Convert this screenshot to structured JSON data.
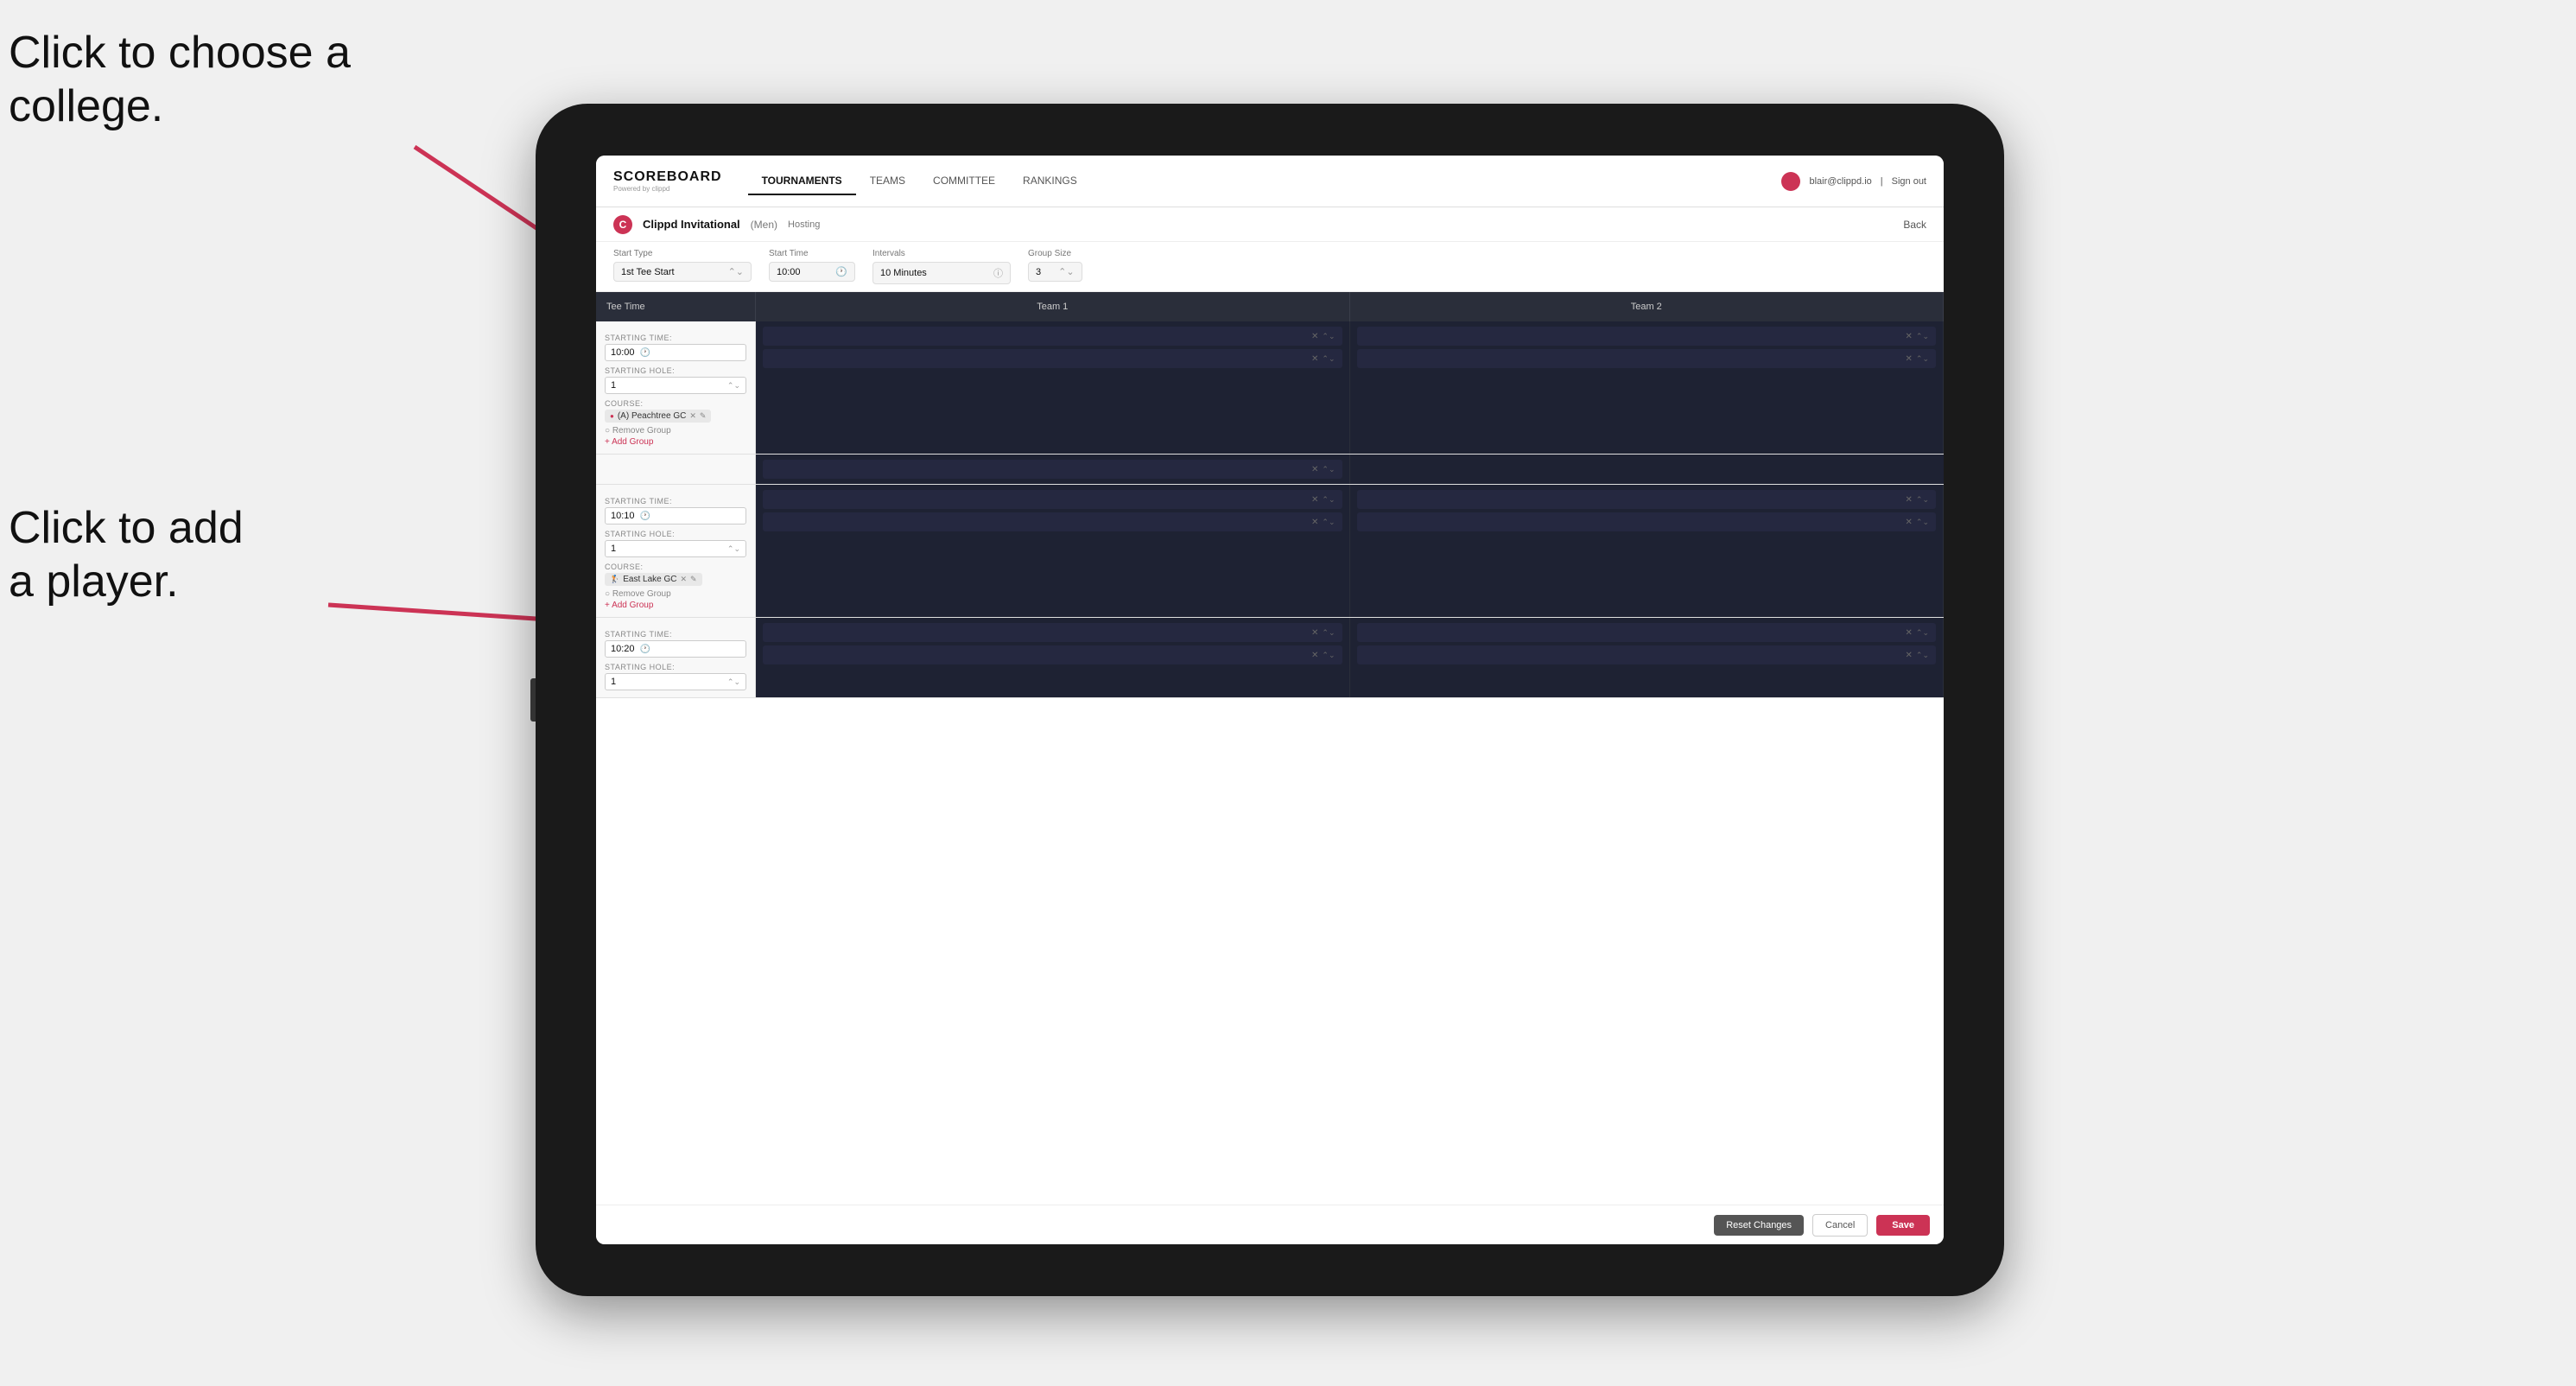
{
  "annotations": {
    "college": "Click to choose a\ncollege.",
    "player": "Click to add\na player."
  },
  "header": {
    "logo_title": "SCOREBOARD",
    "logo_sub": "Powered by clippd",
    "nav_tabs": [
      "TOURNAMENTS",
      "TEAMS",
      "COMMITTEE",
      "RANKINGS"
    ],
    "active_tab": "TOURNAMENTS",
    "user_email": "blair@clippd.io",
    "sign_out": "Sign out"
  },
  "sub_header": {
    "tournament_name": "Clippd Invitational",
    "gender": "(Men)",
    "badge": "Hosting",
    "back": "Back"
  },
  "controls": {
    "start_type_label": "Start Type",
    "start_type_value": "1st Tee Start",
    "start_time_label": "Start Time",
    "start_time_value": "10:00",
    "intervals_label": "Intervals",
    "intervals_value": "10 Minutes",
    "group_size_label": "Group Size",
    "group_size_value": "3"
  },
  "table": {
    "col_tee_time": "Tee Time",
    "col_team1": "Team 1",
    "col_team2": "Team 2"
  },
  "groups": [
    {
      "starting_time": "10:00",
      "starting_hole": "1",
      "course": "(A) Peachtree GC",
      "players_team1": 2,
      "players_team2": 2
    },
    {
      "starting_time": "10:10",
      "starting_hole": "1",
      "course": "East Lake GC",
      "players_team1": 2,
      "players_team2": 2
    },
    {
      "starting_time": "10:20",
      "starting_hole": "1",
      "course": "",
      "players_team1": 2,
      "players_team2": 2
    }
  ],
  "buttons": {
    "reset": "Reset Changes",
    "cancel": "Cancel",
    "save": "Save"
  }
}
